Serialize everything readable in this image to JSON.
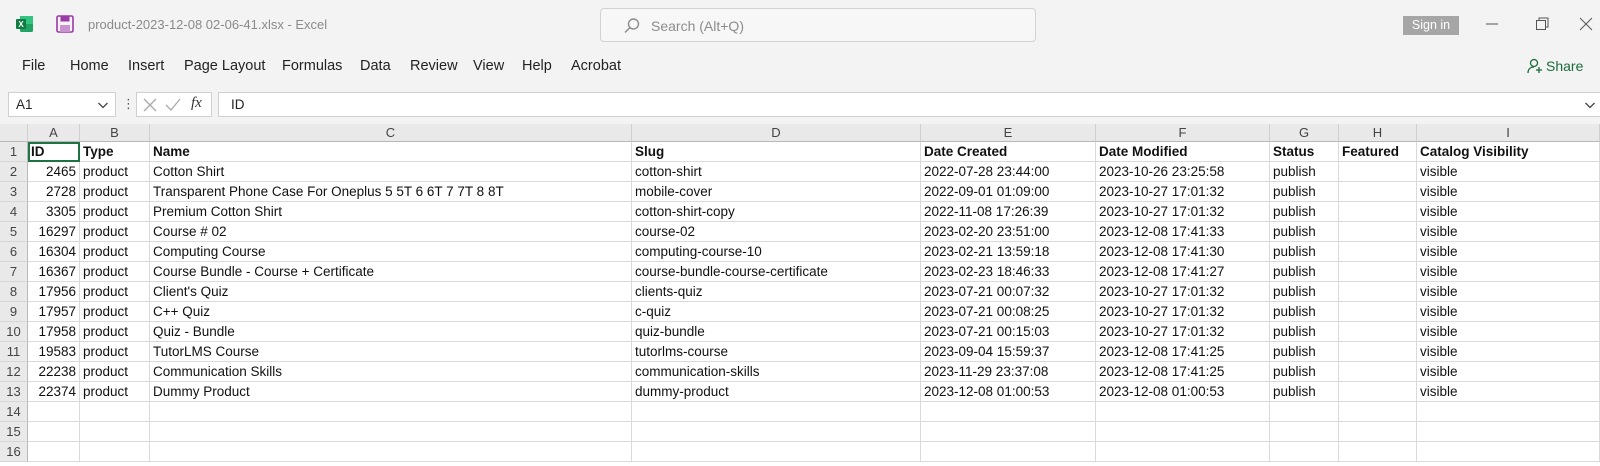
{
  "window": {
    "doc_title": "product-2023-12-08 02-06-41.xlsx  -  Excel",
    "search_placeholder": "Search (Alt+Q)",
    "signin_label": "Sign in",
    "share_label": "Share",
    "accent_color": "#1f7244"
  },
  "menu": [
    "File",
    "Home",
    "Insert",
    "Page Layout",
    "Formulas",
    "Data",
    "Review",
    "View",
    "Help",
    "Acrobat"
  ],
  "formula_bar": {
    "name_box": "A1",
    "fx_label": "fx",
    "content": "ID"
  },
  "sheet": {
    "columns": [
      "A",
      "B",
      "C",
      "D",
      "E",
      "F",
      "G",
      "H",
      "I"
    ],
    "row_numbers": [
      "1",
      "2",
      "3",
      "4",
      "5",
      "6",
      "7",
      "8",
      "9",
      "10",
      "11",
      "12",
      "13",
      "14",
      "15",
      "16"
    ],
    "header": [
      "ID",
      "Type",
      "Name",
      "Slug",
      "Date Created",
      "Date Modified",
      "Status",
      "Featured",
      "Catalog Visibility"
    ],
    "rows": [
      [
        "2465",
        "product",
        "Cotton Shirt",
        "cotton-shirt",
        "2022-07-28 23:44:00",
        "2023-10-26 23:25:58",
        "publish",
        "",
        "visible"
      ],
      [
        "2728",
        "product",
        "Transparent Phone Case For Oneplus 5 5T 6 6T 7 7T 8 8T",
        "mobile-cover",
        "2022-09-01 01:09:00",
        "2023-10-27 17:01:32",
        "publish",
        "",
        "visible"
      ],
      [
        "3305",
        "product",
        "Premium Cotton Shirt",
        "cotton-shirt-copy",
        "2022-11-08 17:26:39",
        "2023-10-27 17:01:32",
        "publish",
        "",
        "visible"
      ],
      [
        "16297",
        "product",
        "Course # 02",
        "course-02",
        "2023-02-20 23:51:00",
        "2023-12-08 17:41:33",
        "publish",
        "",
        "visible"
      ],
      [
        "16304",
        "product",
        "Computing Course",
        "computing-course-10",
        "2023-02-21 13:59:18",
        "2023-12-08 17:41:30",
        "publish",
        "",
        "visible"
      ],
      [
        "16367",
        "product",
        "Course Bundle - Course + Certificate",
        "course-bundle-course-certificate",
        "2023-02-23 18:46:33",
        "2023-12-08 17:41:27",
        "publish",
        "",
        "visible"
      ],
      [
        "17956",
        "product",
        "Client's Quiz",
        "clients-quiz",
        "2023-07-21 00:07:32",
        "2023-10-27 17:01:32",
        "publish",
        "",
        "visible"
      ],
      [
        "17957",
        "product",
        "C++ Quiz",
        "c-quiz",
        "2023-07-21 00:08:25",
        "2023-10-27 17:01:32",
        "publish",
        "",
        "visible"
      ],
      [
        "17958",
        "product",
        "Quiz - Bundle",
        "quiz-bundle",
        "2023-07-21 00:15:03",
        "2023-10-27 17:01:32",
        "publish",
        "",
        "visible"
      ],
      [
        "19583",
        "product",
        "TutorLMS Course",
        "tutorlms-course",
        "2023-09-04 15:59:37",
        "2023-12-08 17:41:25",
        "publish",
        "",
        "visible"
      ],
      [
        "22238",
        "product",
        "Communication Skills",
        "communication-skills",
        "2023-11-29 23:37:08",
        "2023-12-08 17:41:25",
        "publish",
        "",
        "visible"
      ],
      [
        "22374",
        "product",
        "Dummy Product",
        "dummy-product",
        "2023-12-08 01:00:53",
        "2023-12-08 01:00:53",
        "publish",
        "",
        "visible"
      ]
    ]
  }
}
